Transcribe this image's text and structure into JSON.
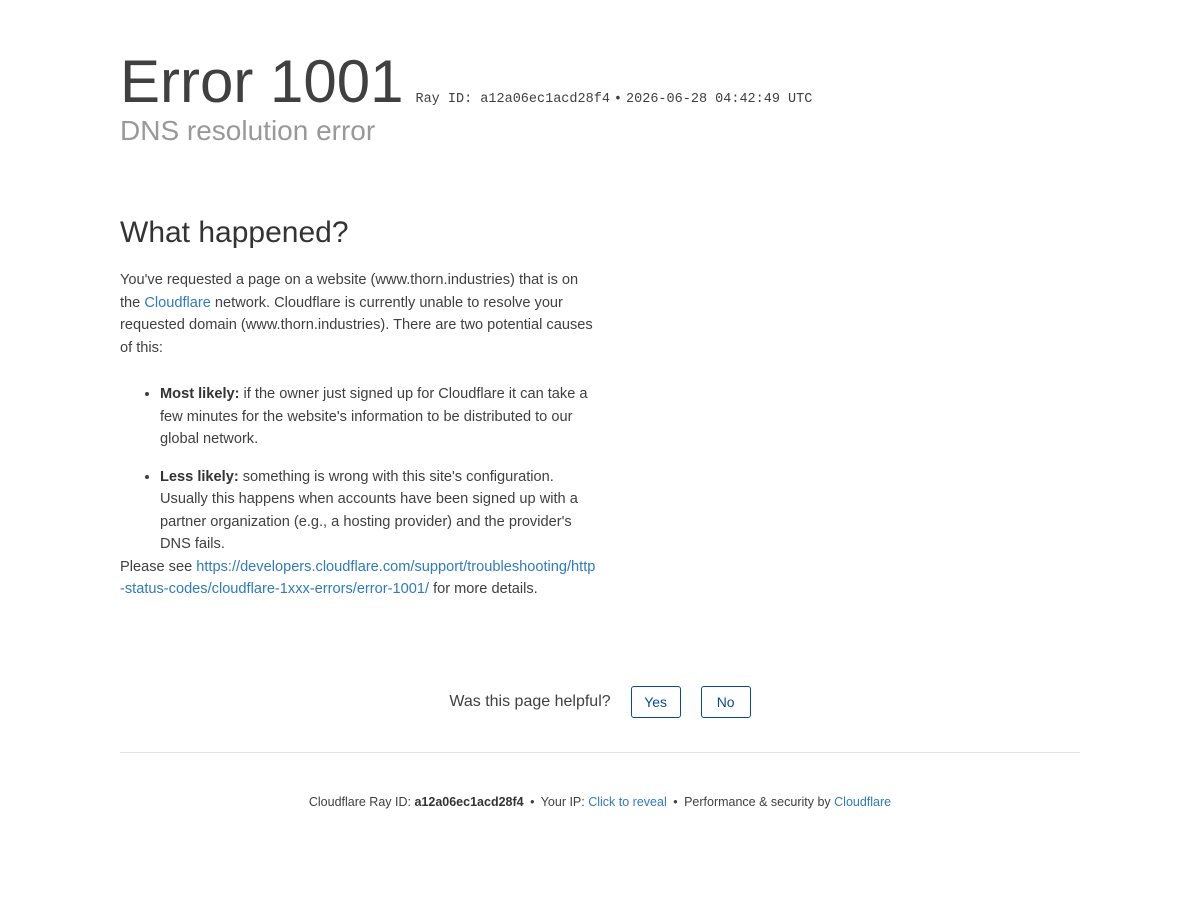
{
  "header": {
    "error_code": "Error 1001",
    "ray_label": "Ray ID: a12a06ec1acd28f4",
    "bullet": "•",
    "timestamp": "2026-06-28 04:42:49 UTC",
    "subtitle": "DNS resolution error"
  },
  "main": {
    "heading": "What happened?",
    "intro_part1": "You've requested a page on a website (www.thorn.industries) that is on the ",
    "intro_link": "Cloudflare",
    "intro_part2": " network. Cloudflare is currently unable to resolve your requested domain (www.thorn.industries). There are two potential causes of this:",
    "causes": [
      {
        "label": "Most likely:",
        "text": " if the owner just signed up for Cloudflare it can take a few minutes for the website's information to be distributed to our global network."
      },
      {
        "label": "Less likely:",
        "text": " something is wrong with this site's configuration. Usually this happens when accounts have been signed up with a partner organization (e.g., a hosting provider) and the provider's DNS fails."
      }
    ],
    "please_see": "Please see ",
    "docs_link": "https://developers.cloudflare.com/support/troubleshooting/http-status-codes/cloudflare-1xxx-errors/error-1001/",
    "more_details": " for more details."
  },
  "feedback": {
    "question": "Was this page helpful?",
    "yes_label": "Yes",
    "no_label": "No"
  },
  "footer": {
    "ray_label": "Cloudflare Ray ID: ",
    "ray_id": "a12a06ec1acd28f4",
    "sep": "•",
    "ip_label": "Your IP: ",
    "ip_link": "Click to reveal",
    "perf_label": "Performance & security by ",
    "cf_link": "Cloudflare"
  },
  "colors": {
    "text": "#404040",
    "subtitle": "#999999",
    "link": "#2f7bbf",
    "button_border": "#0a4b8f"
  }
}
